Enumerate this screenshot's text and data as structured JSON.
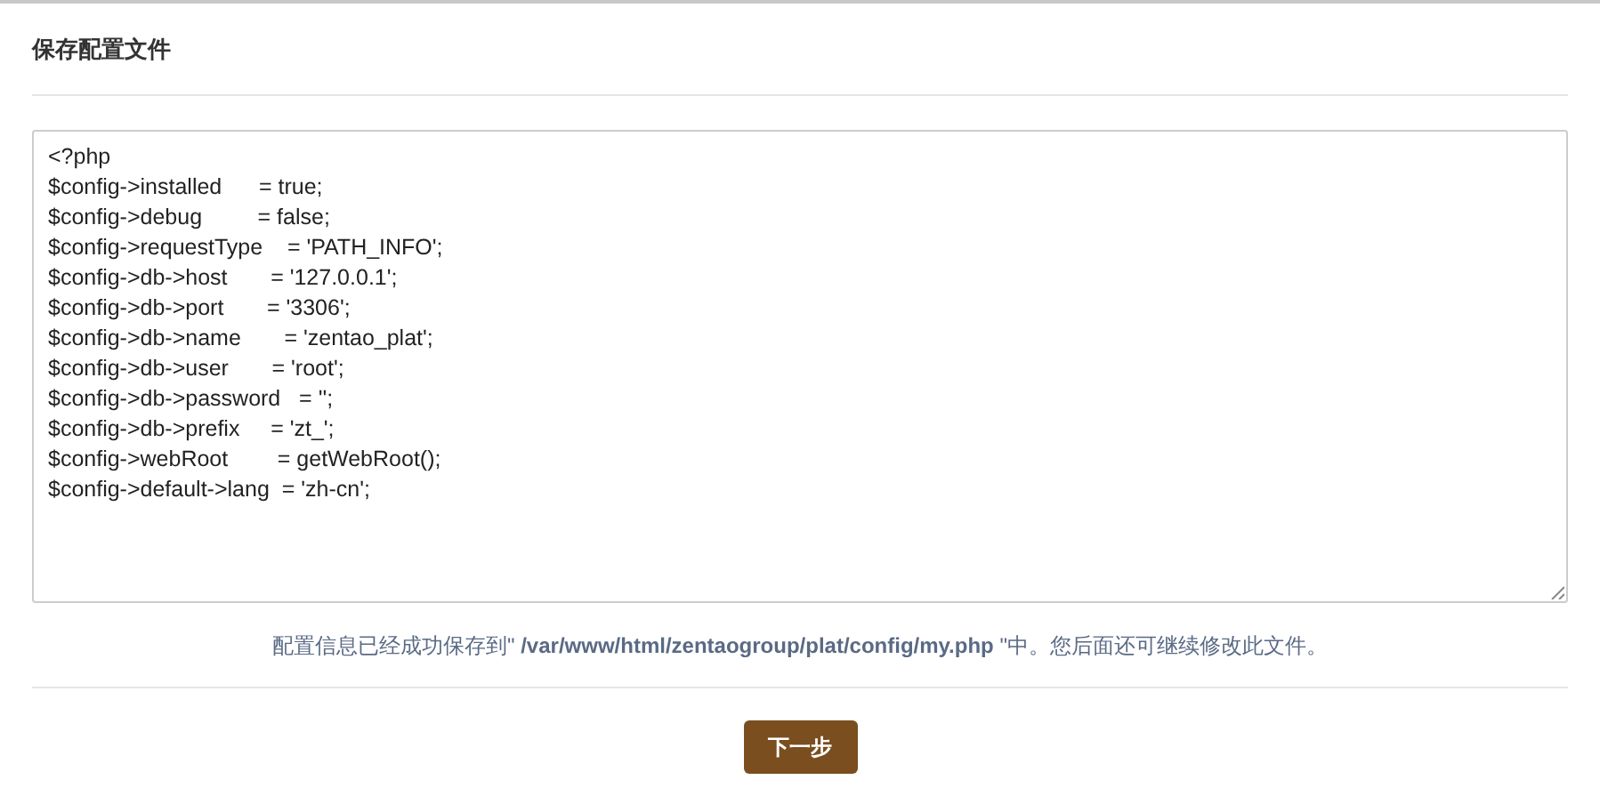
{
  "panel": {
    "title": "保存配置文件"
  },
  "config_text": "<?php\n$config->installed      = true;\n$config->debug         = false;\n$config->requestType    = 'PATH_INFO';\n$config->db->host       = '127.0.0.1';\n$config->db->port       = '3306';\n$config->db->name       = 'zentao_plat';\n$config->db->user       = 'root';\n$config->db->password   = '';\n$config->db->prefix     = 'zt_';\n$config->webRoot        = getWebRoot();\n$config->default->lang  = 'zh-cn';",
  "message": "配置信息已经成功保存到\" **/var/www/html/zentaogroup/plat/config/my.php** \"中。您后面还可继续修改此文件。",
  "next_button": "下一步"
}
